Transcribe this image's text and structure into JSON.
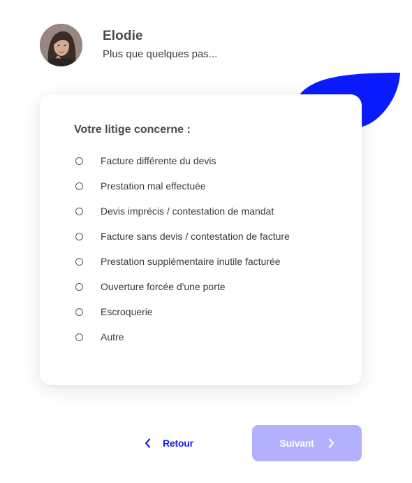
{
  "agent": {
    "name": "Elodie",
    "subtitle": "Plus que quelques pas..."
  },
  "form": {
    "question": "Votre litige concerne :",
    "options": [
      {
        "label": "Facture différente du devis",
        "selected": false
      },
      {
        "label": "Prestation mal effectuée",
        "selected": false
      },
      {
        "label": "Devis imprécis / contestation de mandat",
        "selected": false
      },
      {
        "label": "Facture sans devis / contestation de facture",
        "selected": false
      },
      {
        "label": "Prestation supplémentaire inutile facturée",
        "selected": false
      },
      {
        "label": "Ouverture forcée d'une porte",
        "selected": false
      },
      {
        "label": "Escroquerie",
        "selected": false
      },
      {
        "label": "Autre",
        "selected": false
      }
    ]
  },
  "navigation": {
    "back_label": "Retour",
    "next_label": "Suivant",
    "next_enabled": false
  },
  "colors": {
    "accent": "#1a1aff",
    "leaf": "#0a1cff",
    "next_button_disabled": "#b3b1fe"
  },
  "icons": {
    "back": "chevron-left-icon",
    "next": "chevron-right-icon"
  }
}
